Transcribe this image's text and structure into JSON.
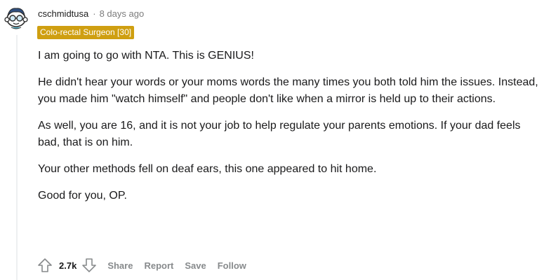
{
  "comment": {
    "username": "cschmidtusa",
    "separator": "·",
    "timestamp": "8 days ago",
    "flair": "Colo-rectal Surgeon [30]",
    "paragraphs": [
      "I am going to go with NTA. This is GENIUS!",
      "He didn't hear your words or your moms words the many times you both told him the issues. Instead, you made him \"watch himself\" and people don't like when a mirror is held up to their actions.",
      "As well, you are 16, and it is not your job to help regulate your parents emotions. If your dad feels bad, that is on him.",
      "Your other methods fell on deaf ears, this one appeared to hit home.",
      "Good for you, OP."
    ],
    "score": "2.7k",
    "actions": {
      "share": "Share",
      "report": "Report",
      "save": "Save",
      "follow": "Follow"
    },
    "icons": {
      "avatar": "snoo-avatar-icon",
      "upvote": "upvote-arrow-icon",
      "downvote": "downvote-arrow-icon"
    },
    "colors": {
      "flair_bg": "#cf9f11",
      "flair_text": "#ffffff",
      "meta_text": "#7c7c7c",
      "action_text": "#878a8c"
    }
  }
}
